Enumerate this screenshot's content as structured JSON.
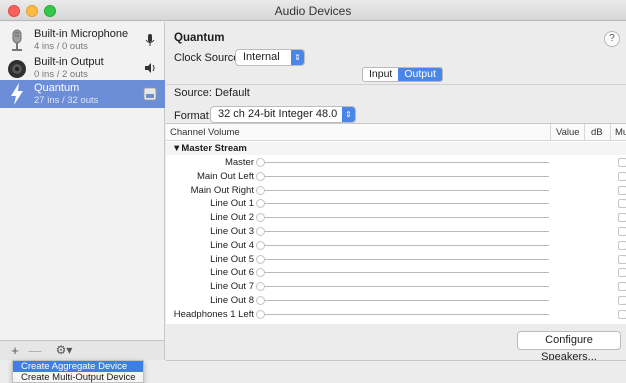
{
  "window": {
    "title": "Audio Devices"
  },
  "sidebar": {
    "devices": [
      {
        "name": "Built-in Microphone",
        "sub": "4 ins / 0 outs",
        "icon": "microphone-icon",
        "right_icon": "mic-input-icon"
      },
      {
        "name": "Built-in Output",
        "sub": "0 ins / 2 outs",
        "icon": "speaker-icon",
        "right_icon": "volume-icon"
      },
      {
        "name": "Quantum",
        "sub": "27 ins / 32 outs",
        "icon": "thunderbolt-icon",
        "right_icon": "finder-icon"
      }
    ],
    "toolbar": {
      "add": "+",
      "remove": "—",
      "gear": "⚙▾"
    }
  },
  "menu": {
    "items": [
      "Create Aggregate Device",
      "Create Multi-Output Device"
    ]
  },
  "main": {
    "device_title": "Quantum",
    "help": "?",
    "clock_source_label": "Clock Source:",
    "clock_source_value": "Internal",
    "tabs": [
      "Input",
      "Output"
    ],
    "active_tab": "Output",
    "source_label": "Source:",
    "source_value": "Default",
    "format_label": "Format:",
    "format_value": "32 ch 24-bit Integer 48.0 kHz",
    "table": {
      "columns": [
        "Channel Volume",
        "Value",
        "dB",
        "Mut"
      ],
      "group": "Master Stream",
      "channels": [
        "Master",
        "Main Out Left",
        "Main Out Right",
        "Line Out 1",
        "Line Out 2",
        "Line Out 3",
        "Line Out 4",
        "Line Out 5",
        "Line Out 6",
        "Line Out 7",
        "Line Out 8",
        "Headphones 1 Left"
      ]
    },
    "configure_button": "Configure Speakers..."
  },
  "colors": {
    "accent": "#4a86e8",
    "selection": "#6c8ed9"
  }
}
